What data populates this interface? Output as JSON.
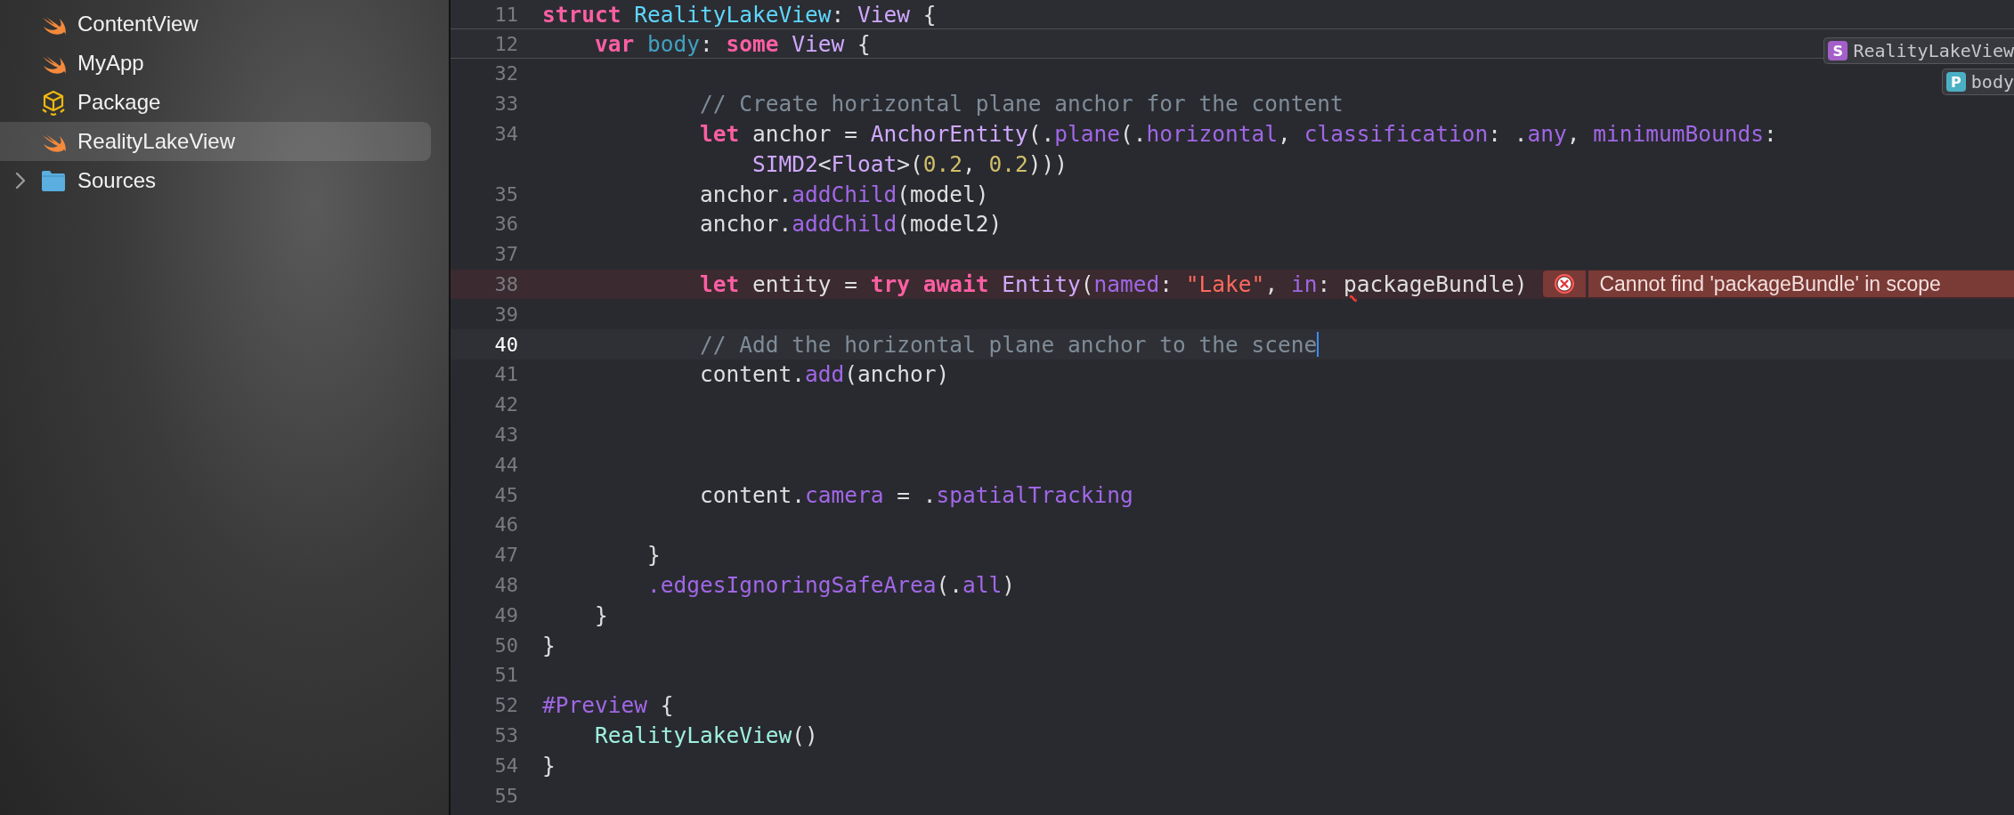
{
  "sidebar": {
    "items": [
      {
        "label": "ContentView",
        "kind": "swift",
        "selected": false
      },
      {
        "label": "MyApp",
        "kind": "swift",
        "selected": false
      },
      {
        "label": "Package",
        "kind": "package",
        "selected": false
      },
      {
        "label": "RealityLakeView",
        "kind": "swift",
        "selected": true
      },
      {
        "label": "Sources",
        "kind": "folder",
        "selected": false,
        "expanded": false
      }
    ]
  },
  "editor": {
    "sticky_lines": [
      {
        "number": "11",
        "tokens": [
          {
            "kind": "keyword",
            "t": "struct "
          },
          {
            "kind": "decl_type",
            "t": "RealityLakeView"
          },
          {
            "kind": "plain",
            "t": ": "
          },
          {
            "kind": "type",
            "t": "View"
          },
          {
            "kind": "plain",
            "t": " {"
          }
        ]
      },
      {
        "number": "12",
        "tokens": [
          {
            "kind": "keyword",
            "t": "    var "
          },
          {
            "kind": "decl_other",
            "t": "body"
          },
          {
            "kind": "plain",
            "t": ": "
          },
          {
            "kind": "keyword",
            "t": "some "
          },
          {
            "kind": "type",
            "t": "View"
          },
          {
            "kind": "plain",
            "t": " {"
          }
        ]
      }
    ],
    "breadcrumbs": [
      {
        "kind": "struct",
        "letter": "S",
        "label": "RealityLakeView"
      },
      {
        "kind": "property",
        "letter": "P",
        "label": "body"
      }
    ],
    "lines": [
      {
        "number": "32",
        "current": false
      },
      {
        "number": "33",
        "current": false,
        "tokens": [
          {
            "kind": "comment",
            "t": "            // Create horizontal plane anchor for the content"
          }
        ]
      },
      {
        "number": "34",
        "current": false,
        "tokens": [
          {
            "kind": "keyword",
            "t": "            let"
          },
          {
            "kind": "plain",
            "t": " anchor = "
          },
          {
            "kind": "type",
            "t": "AnchorEntity"
          },
          {
            "kind": "plain",
            "t": "(."
          },
          {
            "kind": "member",
            "t": "plane"
          },
          {
            "kind": "plain",
            "t": "(."
          },
          {
            "kind": "member",
            "t": "horizontal"
          },
          {
            "kind": "plain",
            "t": ", "
          },
          {
            "kind": "member",
            "t": "classification"
          },
          {
            "kind": "plain",
            "t": ": ."
          },
          {
            "kind": "member",
            "t": "any"
          },
          {
            "kind": "plain",
            "t": ", "
          },
          {
            "kind": "member",
            "t": "minimumBounds"
          },
          {
            "kind": "plain",
            "t": ":"
          }
        ],
        "wrapped": [
          {
            "kind": "type",
            "t": "                SIMD2"
          },
          {
            "kind": "plain",
            "t": "<"
          },
          {
            "kind": "type",
            "t": "Float"
          },
          {
            "kind": "plain",
            "t": ">("
          },
          {
            "kind": "number",
            "t": "0.2"
          },
          {
            "kind": "plain",
            "t": ", "
          },
          {
            "kind": "number",
            "t": "0.2"
          },
          {
            "kind": "plain",
            "t": ")))"
          }
        ]
      },
      {
        "number": "35",
        "current": false,
        "tokens": [
          {
            "kind": "plain",
            "t": "            anchor."
          },
          {
            "kind": "member",
            "t": "addChild"
          },
          {
            "kind": "plain",
            "t": "(model)"
          }
        ]
      },
      {
        "number": "36",
        "current": false,
        "tokens": [
          {
            "kind": "plain",
            "t": "            anchor."
          },
          {
            "kind": "member",
            "t": "addChild"
          },
          {
            "kind": "plain",
            "t": "(model2)"
          }
        ]
      },
      {
        "number": "37",
        "current": false
      },
      {
        "number": "38",
        "current": false,
        "tokens": [
          {
            "kind": "keyword",
            "t": "            let"
          },
          {
            "kind": "plain",
            "t": " entity = "
          },
          {
            "kind": "keyword",
            "t": "try await "
          },
          {
            "kind": "type",
            "t": "Entity"
          },
          {
            "kind": "plain",
            "t": "("
          },
          {
            "kind": "member",
            "t": "named"
          },
          {
            "kind": "plain",
            "t": ": "
          },
          {
            "kind": "string",
            "t": "\"Lake\""
          },
          {
            "kind": "plain",
            "t": ", "
          },
          {
            "kind": "member",
            "t": "in"
          },
          {
            "kind": "plain",
            "t": ": "
          },
          {
            "kind": "plain",
            "t": "p",
            "squiggle": true
          },
          {
            "kind": "plain",
            "t": "ackageBundle)"
          }
        ],
        "error": {
          "message": "Cannot find 'packageBundle' in scope"
        }
      },
      {
        "number": "39",
        "current": false
      },
      {
        "number": "40",
        "current": true,
        "cursor": true,
        "tokens": [
          {
            "kind": "comment",
            "t": "            // Add the horizontal plane anchor to the scene"
          }
        ]
      },
      {
        "number": "41",
        "current": false,
        "tokens": [
          {
            "kind": "plain",
            "t": "            content."
          },
          {
            "kind": "member",
            "t": "add"
          },
          {
            "kind": "plain",
            "t": "(anchor)"
          }
        ]
      },
      {
        "number": "42",
        "current": false
      },
      {
        "number": "43",
        "current": false
      },
      {
        "number": "44",
        "current": false
      },
      {
        "number": "45",
        "current": false,
        "tokens": [
          {
            "kind": "plain",
            "t": "            content."
          },
          {
            "kind": "member",
            "t": "camera"
          },
          {
            "kind": "plain",
            "t": " = ."
          },
          {
            "kind": "member",
            "t": "spatialTracking"
          }
        ]
      },
      {
        "number": "46",
        "current": false
      },
      {
        "number": "47",
        "current": false,
        "tokens": [
          {
            "kind": "plain",
            "t": "        }"
          }
        ]
      },
      {
        "number": "48",
        "current": false,
        "tokens": [
          {
            "kind": "member",
            "t": "        .edgesIgnoringSafeArea"
          },
          {
            "kind": "plain",
            "t": "(."
          },
          {
            "kind": "member",
            "t": "all"
          },
          {
            "kind": "plain",
            "t": ")"
          }
        ]
      },
      {
        "number": "49",
        "current": false,
        "tokens": [
          {
            "kind": "plain",
            "t": "    }"
          }
        ]
      },
      {
        "number": "50",
        "current": false,
        "tokens": [
          {
            "kind": "plain",
            "t": "}"
          }
        ]
      },
      {
        "number": "51",
        "current": false
      },
      {
        "number": "52",
        "current": false,
        "tokens": [
          {
            "kind": "macro",
            "t": "#Preview"
          },
          {
            "kind": "plain",
            "t": " {"
          }
        ]
      },
      {
        "number": "53",
        "current": false,
        "tokens": [
          {
            "kind": "project_type",
            "t": "    RealityLakeView"
          },
          {
            "kind": "plain",
            "t": "()"
          }
        ]
      },
      {
        "number": "54",
        "current": false,
        "tokens": [
          {
            "kind": "plain",
            "t": "}"
          }
        ]
      },
      {
        "number": "55",
        "current": false
      }
    ]
  }
}
